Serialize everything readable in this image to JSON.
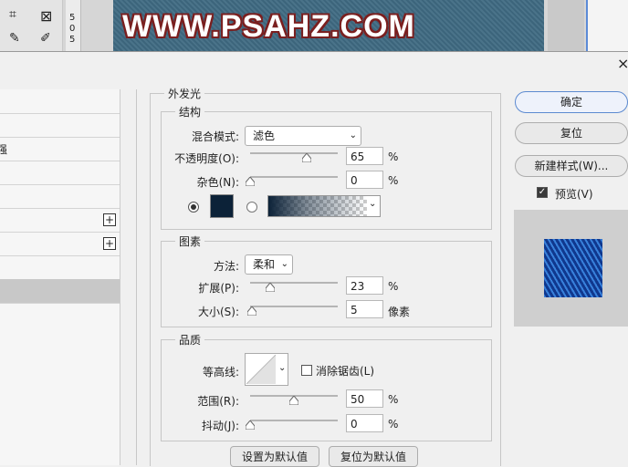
{
  "watermark": "WWW.PSAHZ.COM",
  "ruler_digits": [
    "5",
    "0",
    "5"
  ],
  "left_list": {
    "partial_label": "强"
  },
  "outer_glow": {
    "title": "外发光",
    "structure": {
      "title": "结构",
      "blend_mode_label": "混合模式:",
      "blend_mode_value": "滤色",
      "opacity_label": "不透明度(O):",
      "opacity_value": "65",
      "opacity_fraction": 0.65,
      "noise_label": "杂色(N):",
      "noise_value": "0",
      "noise_fraction": 0,
      "percent": "%",
      "glow_color": "#0c2238"
    },
    "elements": {
      "title": "图素",
      "method_label": "方法:",
      "method_value": "柔和",
      "spread_label": "扩展(P):",
      "spread_value": "23",
      "spread_fraction": 0.23,
      "size_label": "大小(S):",
      "size_value": "5",
      "size_fraction": 0.02,
      "percent": "%",
      "pixels": "像素"
    },
    "quality": {
      "title": "品质",
      "contour_label": "等高线:",
      "antialias_label": "消除锯齿(L)",
      "range_label": "范围(R):",
      "range_value": "50",
      "range_fraction": 0.5,
      "jitter_label": "抖动(J):",
      "jitter_value": "0",
      "jitter_fraction": 0,
      "percent": "%"
    },
    "set_default_label": "设置为默认值",
    "reset_default_label": "复位为默认值"
  },
  "buttons": {
    "ok": "确定",
    "reset": "复位",
    "new_style": "新建样式(W)...",
    "preview": "预览(V)"
  },
  "close_glyph": "×"
}
